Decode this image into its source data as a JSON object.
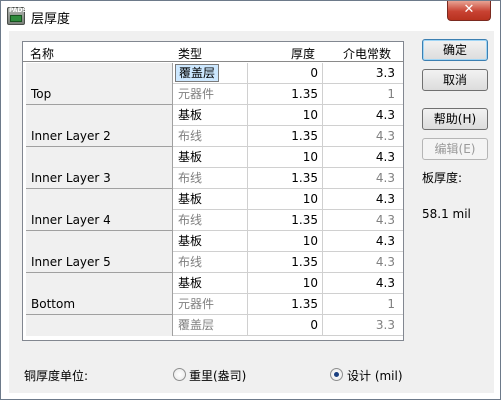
{
  "window": {
    "title": "层厚度",
    "close_glyph": "✕",
    "icon_text": "PADS"
  },
  "table": {
    "columns": [
      "名称",
      "类型",
      "厚度",
      "介电常数"
    ],
    "rows": [
      {
        "name": "",
        "type": "覆盖层",
        "thickness": "0",
        "dielectric": "3.3",
        "selected": true
      },
      {
        "name": "Top",
        "type": "元器件",
        "thickness": "1.35",
        "dielectric": "1",
        "gray": true
      },
      {
        "name": "",
        "type": "基板",
        "thickness": "10",
        "dielectric": "4.3"
      },
      {
        "name": "Inner Layer 2",
        "type": "布线",
        "thickness": "1.35",
        "dielectric": "4.3",
        "gray": true
      },
      {
        "name": "",
        "type": "基板",
        "thickness": "10",
        "dielectric": "4.3"
      },
      {
        "name": "Inner Layer 3",
        "type": "布线",
        "thickness": "1.35",
        "dielectric": "4.3",
        "gray": true
      },
      {
        "name": "",
        "type": "基板",
        "thickness": "10",
        "dielectric": "4.3"
      },
      {
        "name": "Inner Layer 4",
        "type": "布线",
        "thickness": "1.35",
        "dielectric": "4.3",
        "gray": true
      },
      {
        "name": "",
        "type": "基板",
        "thickness": "10",
        "dielectric": "4.3"
      },
      {
        "name": "Inner Layer 5",
        "type": "布线",
        "thickness": "1.35",
        "dielectric": "4.3",
        "gray": true
      },
      {
        "name": "",
        "type": "基板",
        "thickness": "10",
        "dielectric": "4.3"
      },
      {
        "name": "Bottom",
        "type": "元器件",
        "thickness": "1.35",
        "dielectric": "1",
        "gray": true
      },
      {
        "name": "",
        "type": "覆盖层",
        "thickness": "0",
        "dielectric": "3.3",
        "gray": true
      }
    ]
  },
  "buttons": {
    "ok": "确定",
    "cancel": "取消",
    "help": "帮助(H)",
    "edit": "编辑(E)"
  },
  "board_thickness": {
    "label": "板厚度:",
    "value": "58.1 mil"
  },
  "copper_unit": {
    "label": "铜厚度单位:",
    "option_weight": "重里(盎司)",
    "option_design": "设计 (mil)",
    "selected": "design"
  },
  "colors": {
    "selection": "#cde8ff",
    "disabled_text": "#808080"
  }
}
